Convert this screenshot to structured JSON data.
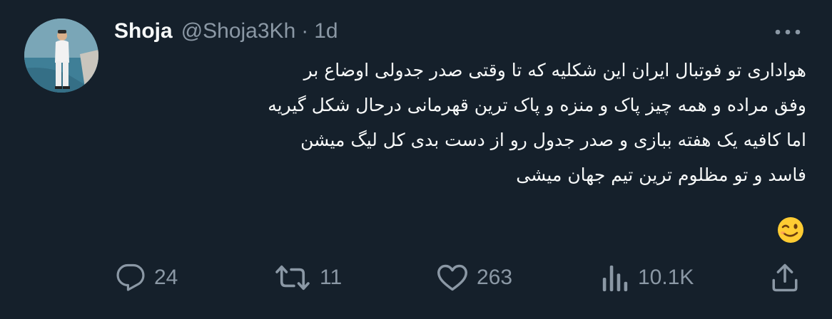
{
  "tweet": {
    "author_name": "Shoja",
    "author_handle": "@Shoja3Kh",
    "separator": "·",
    "time": "1d",
    "text_lines": [
      "هواداری تو فوتبال ایران این شکلیه که تا وقتی صدر جدولی اوضاع بر",
      "وفق مراده و همه چیز پاک و منزه و پاک ترین قهرمانی درحال شکل گیریه",
      "اما کافیه یک هفته ببازی و صدر جدول رو از دست بدی کل لیگ میشن",
      "فاسد و تو مظلوم ترین تیم جهان میشی"
    ],
    "emoji": "winking-face"
  },
  "actions": {
    "replies": "24",
    "retweets": "11",
    "likes": "263",
    "views": "10.1K"
  },
  "icons": {
    "more": "more-horizontal-icon",
    "reply": "reply-bubble-icon",
    "retweet": "retweet-arrows-icon",
    "like": "heart-icon",
    "views": "bar-chart-icon",
    "share": "share-upload-icon"
  },
  "colors": {
    "background": "#15202b",
    "text": "#f7f9f9",
    "secondary": "#8b98a5"
  }
}
